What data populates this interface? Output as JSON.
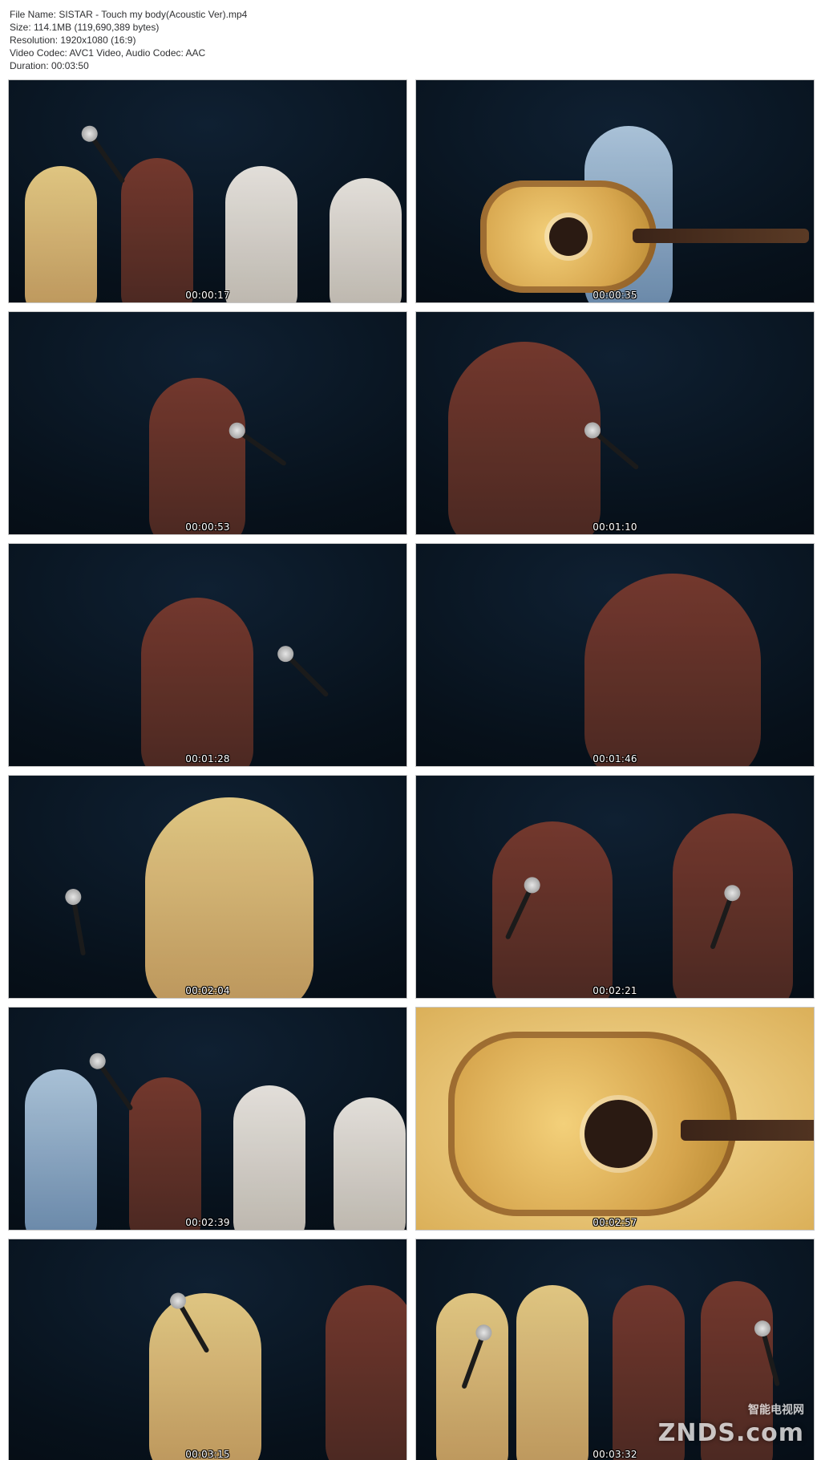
{
  "file_info": {
    "file_name": "File Name: SISTAR - Touch my body(Acoustic Ver).mp4",
    "size": "Size: 114.1MB (119,690,389 bytes)",
    "resolution": "Resolution: 1920x1080 (16:9)",
    "video_codec": "Video Codec: AVC1 Video, Audio Codec: AAC",
    "duration": "Duration: 00:03:50"
  },
  "thumbnails": [
    {
      "timestamp": "00:00:17"
    },
    {
      "timestamp": "00:00:35"
    },
    {
      "timestamp": "00:00:53"
    },
    {
      "timestamp": "00:01:10"
    },
    {
      "timestamp": "00:01:28"
    },
    {
      "timestamp": "00:01:46"
    },
    {
      "timestamp": "00:02:04"
    },
    {
      "timestamp": "00:02:21"
    },
    {
      "timestamp": "00:02:39"
    },
    {
      "timestamp": "00:02:57"
    },
    {
      "timestamp": "00:03:15"
    },
    {
      "timestamp": "00:03:32"
    }
  ],
  "watermark": {
    "cn_text": "智能电视网",
    "brand_text": "ZNDS.com"
  }
}
